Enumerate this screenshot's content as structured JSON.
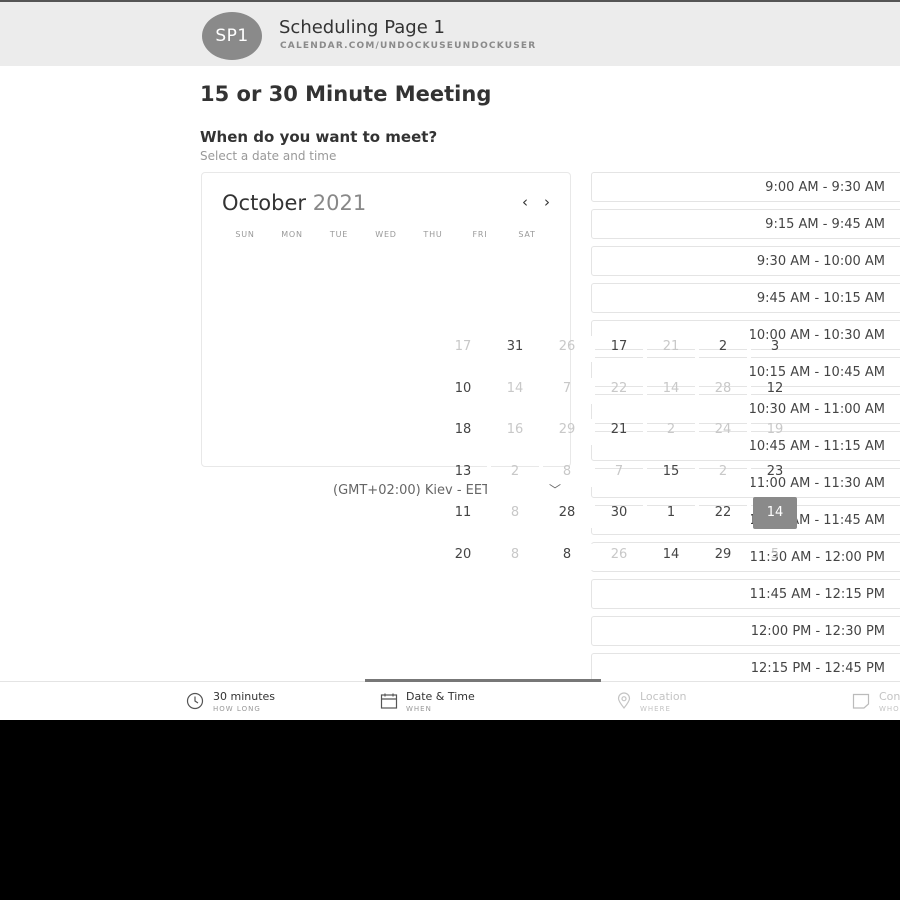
{
  "header": {
    "avatar": "SP1",
    "title": "Scheduling Page 1",
    "url": "CALENDAR.COM/UNDOCKUSEUNDOCKUSER"
  },
  "meeting_title": "15 or 30 Minute Meeting",
  "prompt": {
    "heading": "When do you want to meet?",
    "sub": "Select a date and time"
  },
  "calendar": {
    "month": "October",
    "year": "2021",
    "prev_icon": "chevron-left-icon",
    "next_icon": "chevron-right-icon",
    "weekdays": [
      "SUN",
      "MON",
      "TUE",
      "WED",
      "THU",
      "FRI",
      "SAT"
    ],
    "rows": [
      [
        {
          "t": "17",
          "f": true
        },
        {
          "t": "31"
        },
        {
          "t": "26",
          "f": true
        },
        {
          "t": "17"
        },
        {
          "t": "21",
          "f": true
        },
        {
          "t": "2"
        },
        {
          "t": "3"
        }
      ],
      [
        {
          "t": "10"
        },
        {
          "t": "14",
          "f": true
        },
        {
          "t": "7",
          "f": true
        },
        {
          "t": "22",
          "f": true
        },
        {
          "t": "14",
          "f": true
        },
        {
          "t": "28",
          "f": true
        },
        {
          "t": "12"
        }
      ],
      [
        {
          "t": "18"
        },
        {
          "t": "16",
          "f": true
        },
        {
          "t": "29",
          "f": true
        },
        {
          "t": "21"
        },
        {
          "t": "2",
          "f": true
        },
        {
          "t": "24",
          "f": true
        },
        {
          "t": "19",
          "f": true
        }
      ],
      [
        {
          "t": "13"
        },
        {
          "t": "2",
          "f": true
        },
        {
          "t": "8",
          "f": true
        },
        {
          "t": "7",
          "f": true
        },
        {
          "t": "15"
        },
        {
          "t": "2",
          "f": true
        },
        {
          "t": "23"
        }
      ],
      [
        {
          "t": "11"
        },
        {
          "t": "8",
          "f": true
        },
        {
          "t": "28"
        },
        {
          "t": "30"
        },
        {
          "t": "1"
        },
        {
          "t": "22"
        },
        {
          "t": "14",
          "sel": true
        }
      ],
      [
        {
          "t": "20"
        },
        {
          "t": "8",
          "f": true
        },
        {
          "t": "8"
        },
        {
          "t": "26",
          "f": true
        },
        {
          "t": "14"
        },
        {
          "t": "29"
        },
        {
          "t": "5",
          "f": true
        }
      ]
    ]
  },
  "timezone": "(GMT+02:00) Kiev - EET",
  "timezone_icon": "chevron-down-icon",
  "slots": [
    "9:00 AM - 9:30 AM",
    "9:15 AM - 9:45 AM",
    "9:30 AM - 10:00 AM",
    "9:45 AM - 10:15 AM",
    "10:00 AM - 10:30 AM",
    "10:15 AM - 10:45 AM",
    "10:30 AM - 11:00 AM",
    "10:45 AM - 11:15 AM",
    "11:00 AM - 11:30 AM",
    "11:15 AM - 11:45 AM",
    "11:30 AM - 12:00 PM",
    "11:45 AM - 12:15 PM",
    "12:00 PM - 12:30 PM",
    "12:15 PM - 12:45 PM"
  ],
  "bottom_nav": [
    {
      "label": "30 minutes",
      "sub": "HOW LONG",
      "icon": "clock-icon"
    },
    {
      "label": "Date & Time",
      "sub": "WHEN",
      "icon": "calendar-icon"
    },
    {
      "label": "Location",
      "sub": "WHERE",
      "icon": "location-pin-icon"
    },
    {
      "label": "Confirm",
      "sub": "WHO",
      "icon": "note-icon"
    }
  ]
}
